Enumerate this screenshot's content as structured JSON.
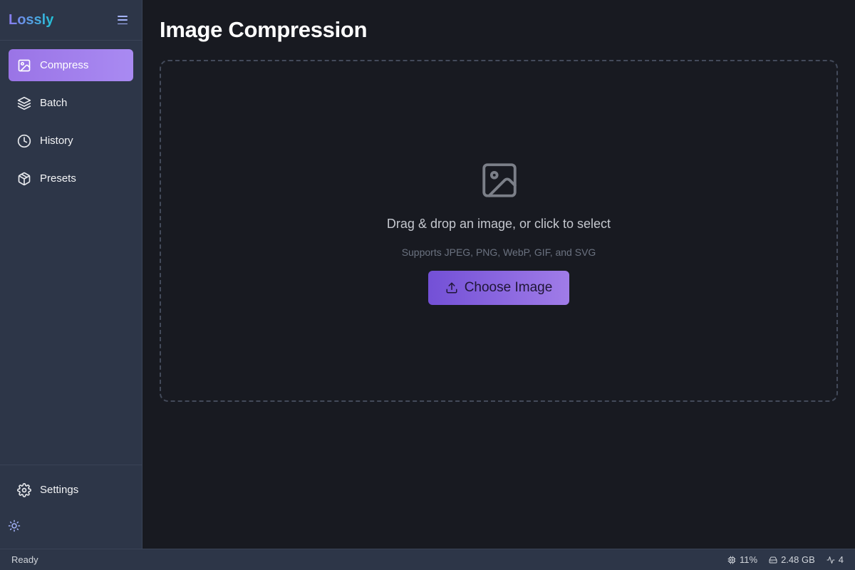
{
  "app": {
    "name": "Lossly"
  },
  "sidebar": {
    "items": [
      {
        "label": "Compress",
        "icon": "image-icon",
        "active": true
      },
      {
        "label": "Batch",
        "icon": "layers-icon",
        "active": false
      },
      {
        "label": "History",
        "icon": "clock-icon",
        "active": false
      },
      {
        "label": "Presets",
        "icon": "box-icon",
        "active": false
      }
    ],
    "settings_label": "Settings",
    "theme_icon": "sun-icon"
  },
  "main": {
    "title": "Image Compression",
    "dropzone": {
      "title": "Drag & drop an image, or click to select",
      "subtitle": "Supports JPEG, PNG, WebP, GIF, and SVG",
      "button_label": "Choose Image",
      "icon": "image-icon"
    }
  },
  "statusbar": {
    "status": "Ready",
    "cpu": "11%",
    "memory": "2.48 GB",
    "tasks": "4"
  },
  "colors": {
    "accent": "#a07ce8",
    "sidebar_bg": "#2d3648",
    "main_bg": "#181a21"
  }
}
